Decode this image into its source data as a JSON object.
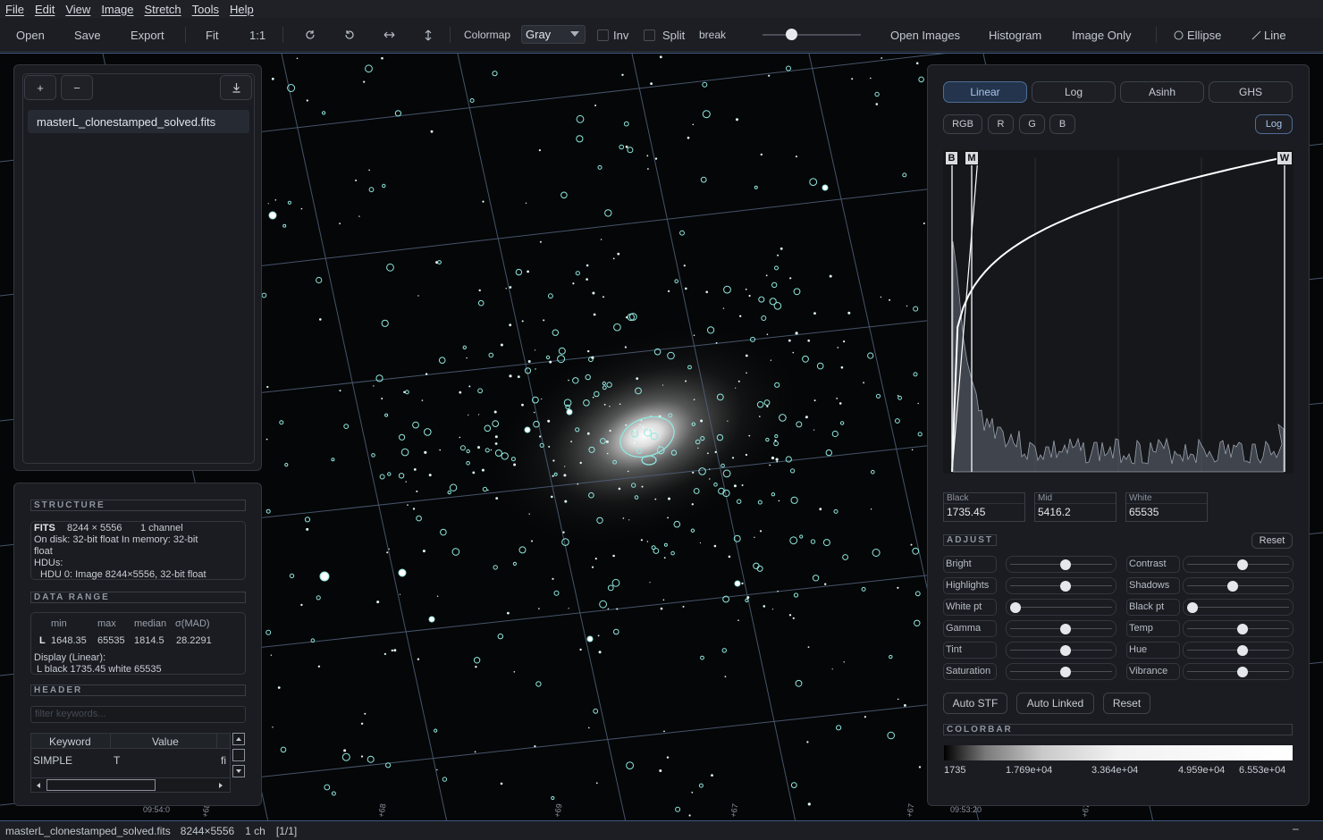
{
  "menu": [
    "File",
    "Edit",
    "View",
    "Image",
    "Stretch",
    "Tools",
    "Help"
  ],
  "toolbar": {
    "open": "Open",
    "save": "Save",
    "export": "Export",
    "fit": "Fit",
    "one_to_one": "1:1",
    "colormap_label": "Colormap",
    "colormap_value": "Gray",
    "inv": "Inv",
    "split": "Split",
    "break": "break",
    "open_images": "Open Images",
    "histogram": "Histogram",
    "image_only": "Image Only",
    "ellipse": "Ellipse",
    "line": "Line",
    "split_position": 0.29
  },
  "files": {
    "add": "+",
    "remove": "−",
    "items": [
      "masterL_clonestamped_solved.fits"
    ]
  },
  "info": {
    "structure_head": "STRUCTURE",
    "fits_label": "FITS",
    "dims": "8244 × 5556",
    "channels": "1 channel",
    "disk_line": "On disk: 32-bit float   In memory: 32-bit",
    "disk_line2": "float",
    "hdus": "HDUs:",
    "hdu0": "HDU 0: Image 8244×5556, 32-bit float",
    "range_head": "DATA RANGE",
    "cols": [
      "min",
      "max",
      "median",
      "σ(MAD)"
    ],
    "row_label": "L",
    "row_vals": [
      "1648.35",
      "65535",
      "1814.5",
      "28.2291"
    ],
    "display": "Display (Linear):",
    "display_vals": "L black 1735.45   white 65535",
    "header_head": "HEADER",
    "filter_placeholder": "filter keywords...",
    "table_cols": [
      "Keyword",
      "Value"
    ],
    "table_row": [
      "SIMPLE",
      "T",
      "fi"
    ]
  },
  "histogram": {
    "stretch_tabs": [
      "Linear",
      "Log",
      "Asinh",
      "GHS"
    ],
    "active_tab": "Linear",
    "channels": [
      "RGB",
      "R",
      "G",
      "B"
    ],
    "log_btn": "Log",
    "markers": [
      "B",
      "M",
      "W"
    ],
    "black_label": "Black",
    "black_val": "1735.45",
    "mid_label": "Mid",
    "mid_val": "5416.2",
    "white_label": "White",
    "white_val": "65535",
    "adjust_head": "ADJUST",
    "reset": "Reset",
    "adjust_left": [
      {
        "label": "Bright",
        "level": 0.5
      },
      {
        "label": "Highlights",
        "level": 0.5
      },
      {
        "label": "White pt",
        "level": 0.0
      },
      {
        "label": "Gamma",
        "level": 0.5
      },
      {
        "label": "Tint",
        "level": 0.5
      },
      {
        "label": "Saturation",
        "level": 0.5
      }
    ],
    "adjust_right": [
      {
        "label": "Contrast",
        "level": 0.5
      },
      {
        "label": "Shadows",
        "level": 0.4
      },
      {
        "label": "Black pt",
        "level": 0.0
      },
      {
        "label": "Temp",
        "level": 0.5
      },
      {
        "label": "Hue",
        "level": 0.5
      },
      {
        "label": "Vibrance",
        "level": 0.5
      }
    ],
    "auto_stf": "Auto STF",
    "auto_linked": "Auto Linked",
    "reset2": "Reset",
    "colorbar_head": "COLORBAR",
    "colorbar_ticks": [
      "1735",
      "1.769e+04",
      "3.364e+04",
      "4.959e+04",
      "6.553e+04"
    ]
  },
  "grid_labels": [
    "09:54:0",
    "+68",
    "+68",
    "+69",
    "+67",
    "+67",
    "09:53:20"
  ],
  "status": {
    "file": "masterL_clonestamped_solved.fits",
    "dims": "8244×5556",
    "channels": "1 ch",
    "index": "[1/1]",
    "minimize": "–"
  }
}
